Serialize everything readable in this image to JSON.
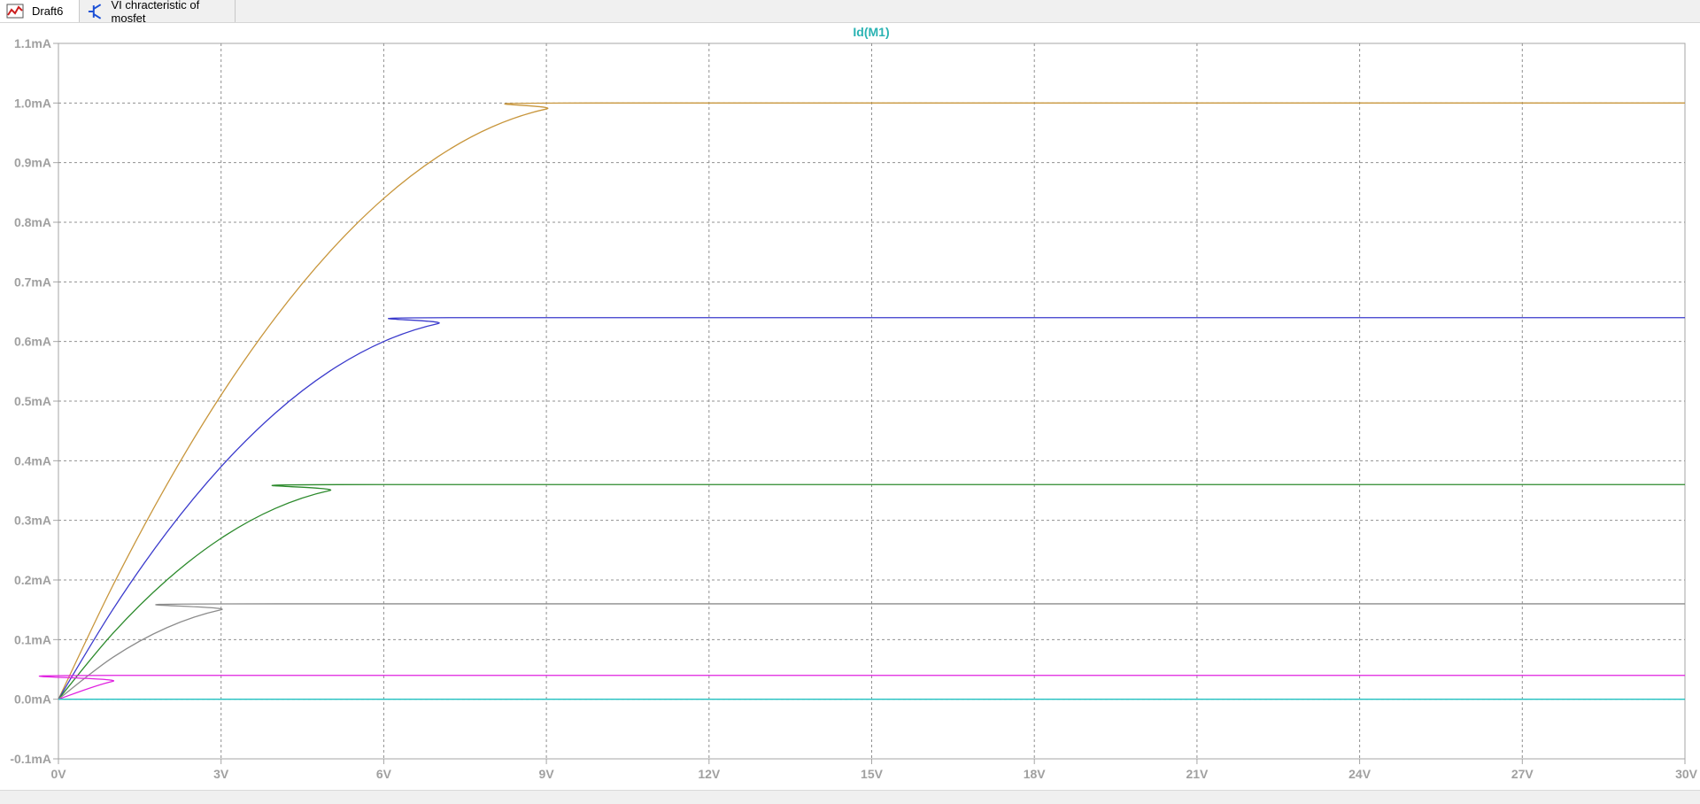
{
  "tabs": [
    {
      "label": "Draft6",
      "icon": "waveform-icon",
      "active": true
    },
    {
      "label": "VI chracteristic of mosfet",
      "icon": "transistor-icon",
      "active": false
    }
  ],
  "chart_data": {
    "type": "line",
    "title": "Id(M1)",
    "xlabel": "",
    "ylabel": "",
    "xlim": [
      0,
      30
    ],
    "ylim": [
      -0.1,
      1.1
    ],
    "x_unit": "V",
    "y_unit": "mA",
    "xticks": [
      "0V",
      "3V",
      "6V",
      "9V",
      "12V",
      "15V",
      "18V",
      "21V",
      "24V",
      "27V",
      "30V"
    ],
    "yticks": [
      "-0.1mA",
      "0.0mA",
      "0.1mA",
      "0.2mA",
      "0.3mA",
      "0.4mA",
      "0.5mA",
      "0.6mA",
      "0.7mA",
      "0.8mA",
      "0.9mA",
      "1.0mA",
      "1.1mA"
    ],
    "grid": true,
    "colors": {
      "title": "#2ab3b3",
      "tick_text": "#a0a0a0",
      "grid": "#909090",
      "axis": "#a6a6a6"
    },
    "series": [
      {
        "color": "#c8963c",
        "x": [
          0,
          1,
          2,
          3,
          4,
          5,
          6,
          7,
          8,
          9,
          10,
          30
        ],
        "y": [
          0,
          0.19,
          0.36,
          0.51,
          0.64,
          0.75,
          0.84,
          0.91,
          0.96,
          0.99,
          1.0,
          1.0
        ]
      },
      {
        "color": "#3a3acc",
        "x": [
          0,
          1,
          2,
          3,
          4,
          5,
          6,
          7,
          8,
          30
        ],
        "y": [
          0,
          0.15,
          0.28,
          0.39,
          0.48,
          0.55,
          0.6,
          0.63,
          0.64,
          0.64
        ]
      },
      {
        "color": "#2c8a2c",
        "x": [
          0,
          1,
          2,
          3,
          4,
          5,
          6,
          30
        ],
        "y": [
          0,
          0.11,
          0.2,
          0.27,
          0.32,
          0.35,
          0.36,
          0.36
        ]
      },
      {
        "color": "#8c8c8c",
        "x": [
          0,
          1,
          2,
          3,
          4,
          30
        ],
        "y": [
          0,
          0.07,
          0.12,
          0.15,
          0.16,
          0.16
        ]
      },
      {
        "color": "#e020e0",
        "x": [
          0,
          1,
          2,
          30
        ],
        "y": [
          0,
          0.03,
          0.04,
          0.04
        ]
      },
      {
        "color": "#20c0c0",
        "x": [
          0,
          30
        ],
        "y": [
          0,
          0
        ]
      }
    ]
  }
}
